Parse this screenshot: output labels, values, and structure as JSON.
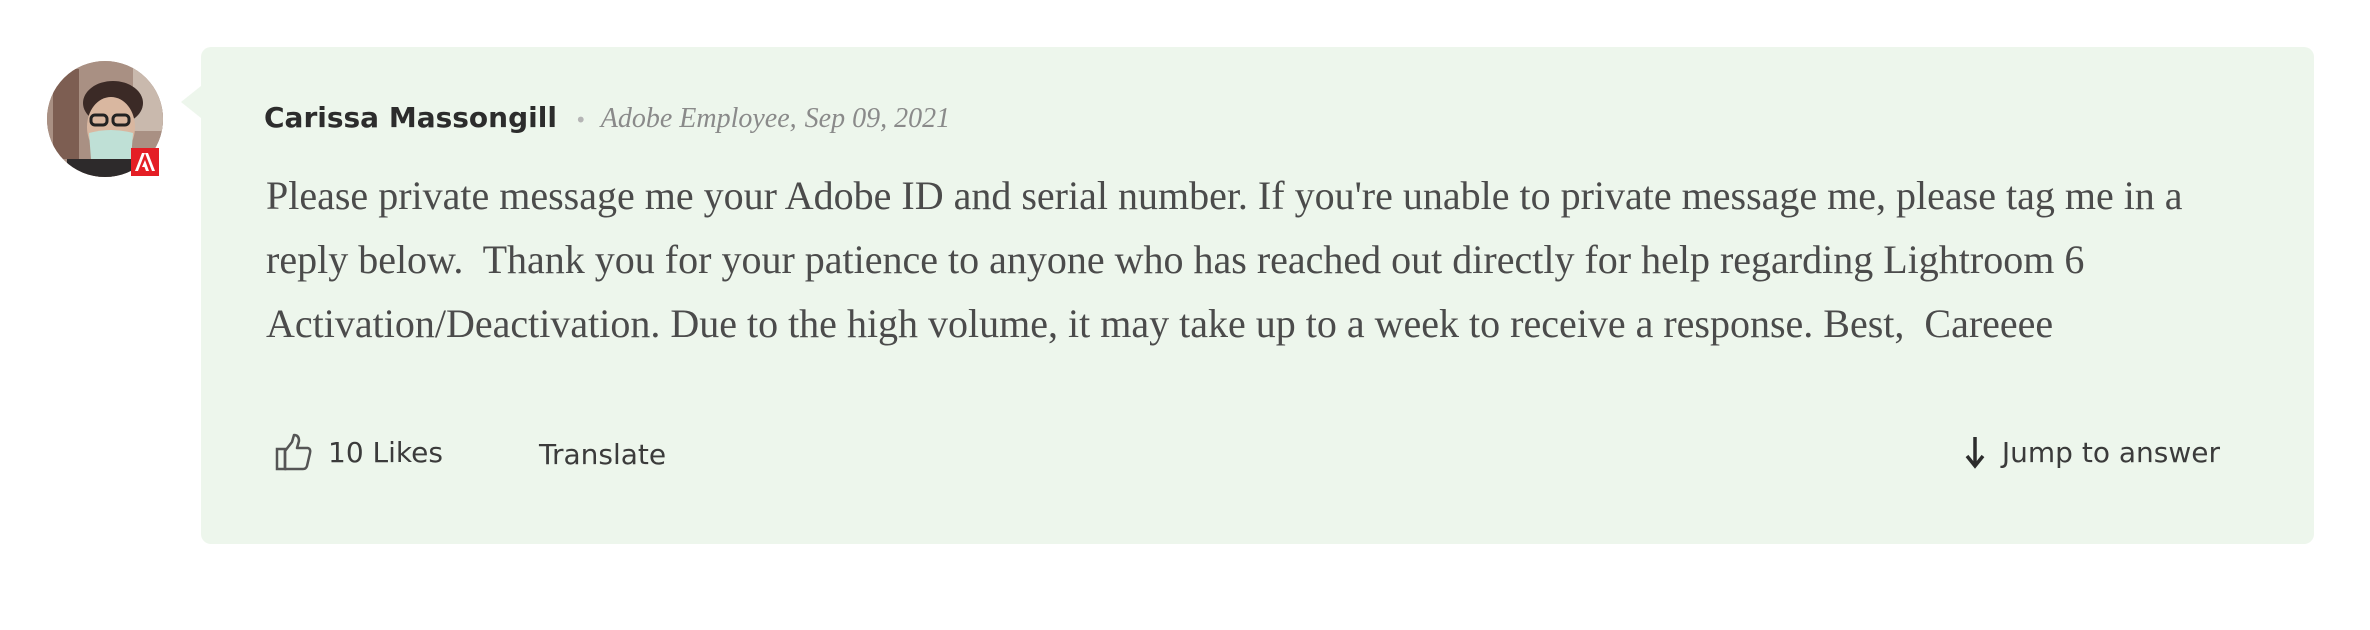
{
  "post": {
    "author": {
      "name": "Carissa Massongill",
      "role": "Adobe Employee",
      "avatar_icon": "user-avatar-photo",
      "badge_icon": "adobe-logo-icon",
      "badge_color": "#e41e25"
    },
    "separator": "•",
    "comma": ",",
    "date": "Sep 09, 2021",
    "body": "Please private message me your Adobe ID and serial number. If you're unable to private message me, please tag me in a reply below.  Thank you for your patience to anyone who has reached out directly for help regarding Lightroom 6 Activation/Deactivation. Due to the high volume, it may take up to a week to receive a response. Best,  Careeee",
    "card_color": "#edf6ec"
  },
  "actions": {
    "like_icon": "thumbs-up-icon",
    "likes_label": "10 Likes",
    "translate_label": "Translate",
    "jump_icon": "arrow-down-icon",
    "jump_label": "Jump to answer"
  }
}
